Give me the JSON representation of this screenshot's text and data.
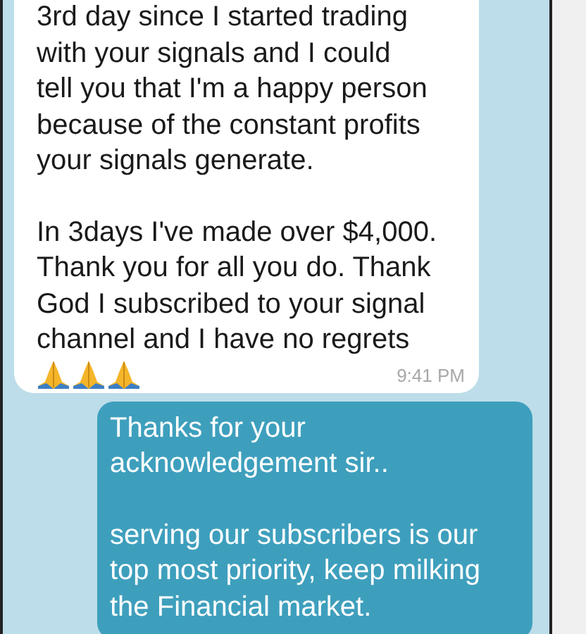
{
  "messages": [
    {
      "kind": "incoming",
      "paragraphs": [
        "3rd day since I started trading\nwith your signals and I could\ntell you that I'm a happy person\nbecause of the constant profits\nyour signals generate.",
        "In 3days I've made over $4,000.\nThank you for all you do. Thank\nGod I subscribed to your signal\nchannel and I have no regrets"
      ],
      "time": "9:41 PM"
    },
    {
      "kind": "outgoing",
      "paragraphs": [
        "Thanks for your\nacknowledgement sir..",
        "serving our subscribers is our\ntop most priority, keep milking\nthe Financial market."
      ]
    }
  ]
}
